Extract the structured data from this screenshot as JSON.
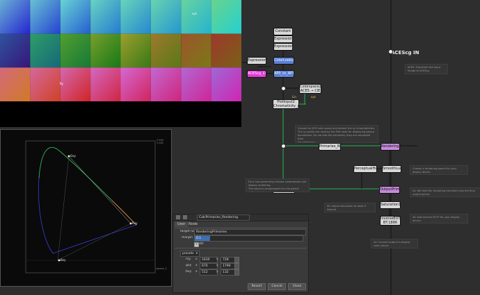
{
  "graph": {
    "aces_title": "ACEScg IN",
    "nodes": {
      "constant": "Constant",
      "expression7": "Expression7",
      "expression2": "Expression2",
      "expression8": "Expression8",
      "lookup": "ColorLookup4",
      "label_pink": "ACEScg_LIN",
      "label_blue": "AP0_to_AP1",
      "colorspace": "Colorspace2\nACES → CIE XYZ",
      "plotinput": "PlotInput2\nChromaticity_plot",
      "primaries_rend": "Primaries_Rendering",
      "renderingprimaries": "RenderingPrimaries",
      "perceptual": "PerceptualHueAdjust",
      "smoothlum": "SmoothLuminance",
      "outputprimaries": "OutputPrimaries",
      "plotprimaries": "PlotPrimariesOut",
      "saturation": "Saturation1",
      "inverseeotf": "InverseEOTF\nBT.1886"
    },
    "pins": {
      "xyz": "xyz",
      "ry": "Ry",
      "rxy": "Rxy",
      "lin": "Lin"
    },
    "notes": [
      "ACES: Transform the input image to ACEScg",
      "Convert to XYZ color space and extract the xy chromaticities.\nThe xy points are used by the Plot node for displaying gamut\nboundaries. Do not edit the primaries; they are computed from\nthe reference.",
      "Do a hue-preserving chroma compression and display rendering.\nThe result is compressed into the gamut defined by the primaries.",
      "Choose a rendering gamut for your display device",
      "All: We feed the rendering transform into the final output gamut",
      "All: Adjust saturation to taste if desired",
      "All: Add inverse EOTF for your display device",
      "All: Convert output to display code values",
      "All: Some comments here"
    ]
  },
  "viewer_top": {
    "axis_hi": "1.0",
    "marker": "xyz",
    "marker2": "Ry"
  },
  "viewer_bottom": {
    "tick_top": "0.860 0.860",
    "tick_bottom": "square_2",
    "pt_green": "Gxy",
    "pt_red": "Rxy",
    "pt_blue": "Bxy"
  },
  "inspector": {
    "node_name": "CalcPrimaries_Rendering",
    "tabs": [
      "User",
      "Node"
    ],
    "target_node_label": "target node",
    "target_node_value": "RenderingPrimaries",
    "margin_label": "margin",
    "margin_value": "0.1",
    "dsl_label": "dsl",
    "dsl_checked": true,
    "dropdown_value": "presets",
    "rows": [
      {
        "label": "rxy",
        "x": "1630",
        "y": "728"
      },
      {
        "label": "gxy",
        "x": "670",
        "y": "1790"
      },
      {
        "label": "bxy",
        "x": "512",
        "y": "132"
      }
    ],
    "x_prefix": "x",
    "y_prefix": "y",
    "buttons": {
      "revert": "Revert",
      "cancel": "Cancel",
      "close": "Close"
    }
  }
}
